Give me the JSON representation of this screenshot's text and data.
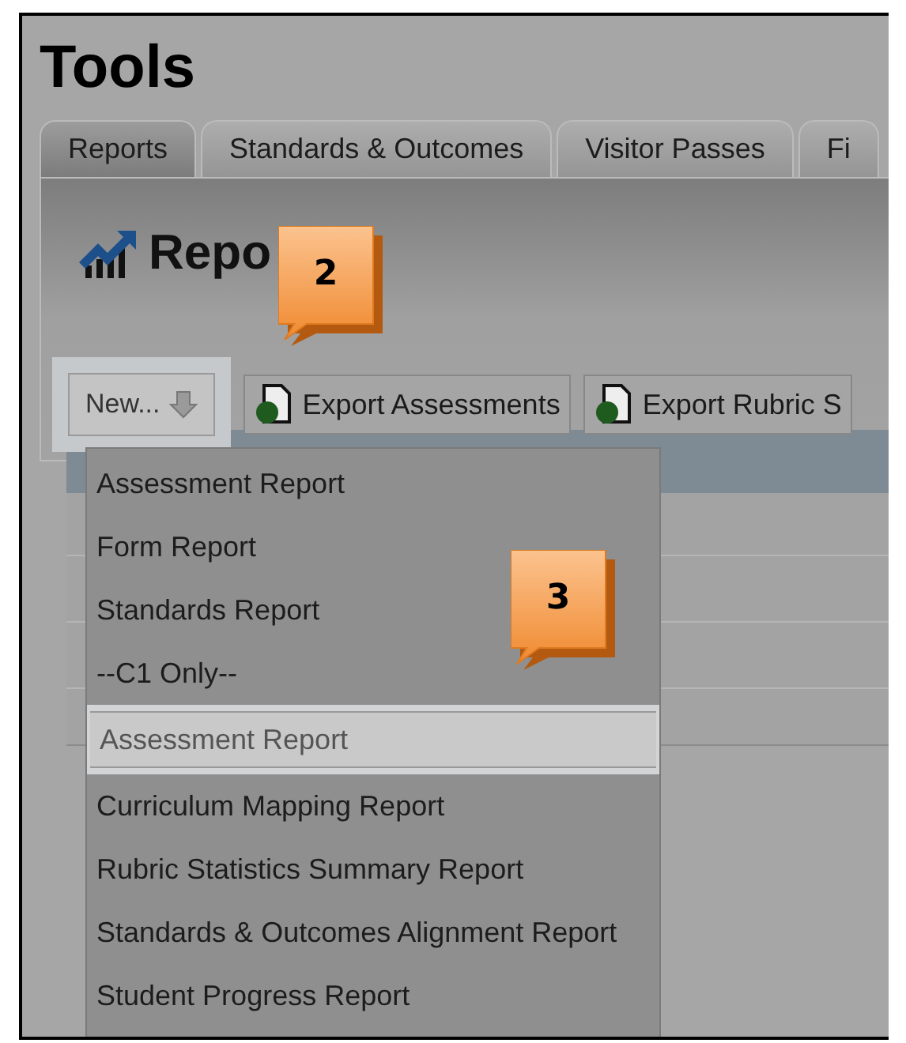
{
  "page_title": "Tools",
  "tabs": [
    {
      "label": "Reports",
      "selected": true
    },
    {
      "label": "Standards & Outcomes",
      "selected": false
    },
    {
      "label": "Visitor Passes",
      "selected": false
    },
    {
      "label": "Fi",
      "selected": false
    }
  ],
  "section_heading": "Repo",
  "toolbar": {
    "new_button": "New...",
    "buttons": [
      "Export Assessments",
      "Export Rubric S"
    ]
  },
  "menu": [
    {
      "label": "Assessment Report",
      "selected": false
    },
    {
      "label": "Form Report",
      "selected": false
    },
    {
      "label": "Standards Report",
      "selected": false
    },
    {
      "label": "--C1 Only--",
      "selected": false
    },
    {
      "label": "Assessment Report",
      "selected": true
    },
    {
      "label": "Curriculum Mapping Report",
      "selected": false
    },
    {
      "label": "Rubric Statistics Summary Report",
      "selected": false
    },
    {
      "label": "Standards & Outcomes Alignment Report",
      "selected": false
    },
    {
      "label": "Student Progress Report",
      "selected": false
    }
  ],
  "callouts": [
    "2",
    "3"
  ]
}
